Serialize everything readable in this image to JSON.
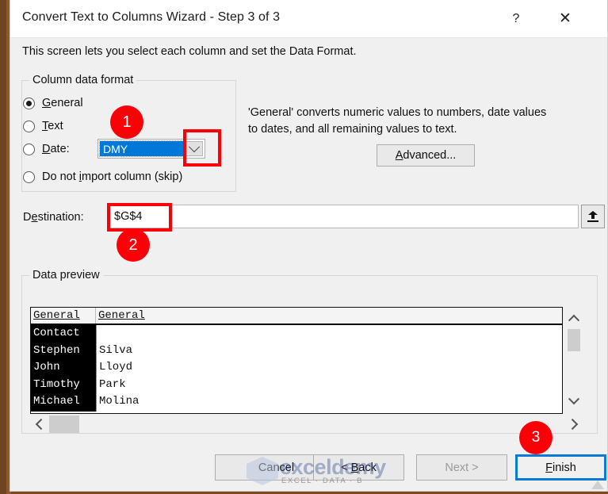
{
  "window": {
    "title": "Convert Text to Columns Wizard - Step 3 of 3",
    "help_icon": "?",
    "close_icon": "✕",
    "instruction": "This screen lets you select each column and set the Data Format."
  },
  "column_format": {
    "legend": "Column data format",
    "options": [
      {
        "label": "General",
        "accel": "G",
        "selected": true
      },
      {
        "label": "Text",
        "accel": "T",
        "selected": false
      },
      {
        "label": "Date:",
        "accel": "D",
        "selected": false
      },
      {
        "label": "Do not import column (skip)",
        "accel": "i",
        "selected": false
      }
    ],
    "date_combo_value": "DMY",
    "date_combo_icon": "chevron-down-icon"
  },
  "description": {
    "line1": "'General' converts numeric values to numbers, date values",
    "line2": "to dates, and all remaining values to text."
  },
  "advanced_button": {
    "label": "Advanced...",
    "accel": "A"
  },
  "destination": {
    "label": "Destination:",
    "value": "$G$4",
    "collapse_icon": "range-collapse-icon"
  },
  "data_preview": {
    "legend": "Data preview",
    "headers": [
      "General",
      "General"
    ],
    "rows": [
      [
        "Contact",
        ""
      ],
      [
        "Stephen",
        "Silva"
      ],
      [
        "John",
        "Lloyd"
      ],
      [
        "Timothy",
        "Park"
      ],
      [
        "Michael",
        "Molina"
      ]
    ],
    "selected_column_index": 0,
    "scroll_up_icon": "chevron-up-icon",
    "scroll_down_icon": "chevron-down-icon",
    "scroll_left_icon": "chevron-left-icon",
    "scroll_right_icon": "chevron-right-icon"
  },
  "buttons": {
    "cancel": "Cancel",
    "back": "< Back",
    "back_accel": "B",
    "next": "Next >",
    "finish": "Finish",
    "finish_accel": "F"
  },
  "callouts": {
    "one": "1",
    "two": "2",
    "three": "3"
  },
  "watermark": {
    "brand": "exceldemy",
    "tagline": "EXCEL · DATA · B"
  },
  "colors": {
    "accent_red": "#fb0007",
    "focus_blue": "#0b7ad6",
    "selection_blue": "#0078d7"
  }
}
